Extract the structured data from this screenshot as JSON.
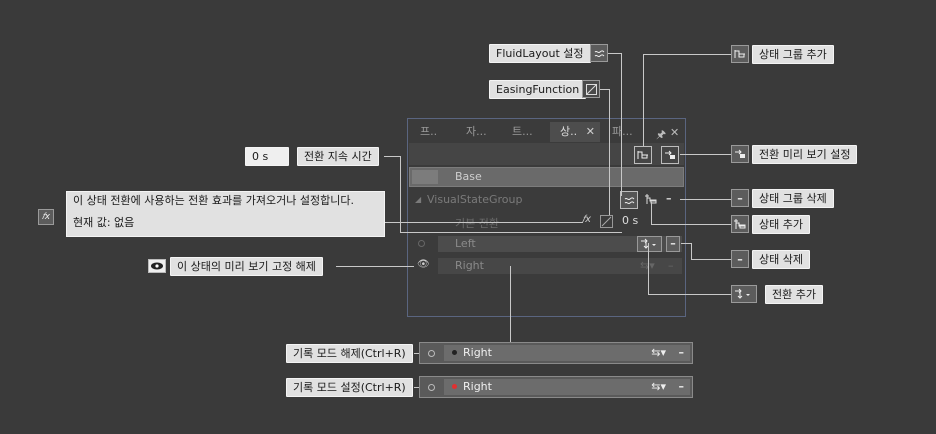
{
  "callouts": {
    "fluid_layout": "FluidLayout 설정",
    "easing_function": "EasingFunction",
    "add_state_group": "상태 그룹 추가",
    "transition_preview": "전환 미리 보기 설정",
    "delete_state_group": "상태 그룹 삭제",
    "add_state": "상태 추가",
    "delete_state": "상태 삭제",
    "add_transition": "전환 추가",
    "transition_duration": "전환 지속 시간",
    "duration_input_value": "0 s",
    "unpin_preview": "이 상태의 미리 보기 고정 해제",
    "tooltip_line1": "이 상태 전환에 사용하는 전환 효과를 가져오거나 설정합니다.",
    "tooltip_line2": "현재 값: 없음",
    "record_off": "기록 모드 해제(Ctrl+R)",
    "record_on": "기록 모드 설정(Ctrl+R)"
  },
  "panel": {
    "tabs": [
      "프..",
      "자...",
      "트...",
      "상..",
      "파..."
    ],
    "active_tab_index": 3,
    "base_label": "Base",
    "group_name": "VisualStateGroup",
    "default_transition": "기본 전환",
    "default_duration": "0 s",
    "states": [
      "Left",
      "Right"
    ]
  },
  "record_rows": {
    "row1_state": "Right",
    "row2_state": "Right",
    "record_off_dot_color": "#222222",
    "record_on_dot_color": "#e03030"
  },
  "icons": {
    "fluid_layout": "fluid-layout-icon",
    "easing": "easing-icon",
    "add_state_group": "add-state-group-icon",
    "transition_preview": "transition-preview-icon",
    "delete": "minus-icon",
    "add_state": "add-state-icon",
    "add_transition": "add-transition-icon",
    "eye": "eye-icon",
    "fx": "fx-icon",
    "pin": "pin-icon",
    "close": "close-icon"
  }
}
